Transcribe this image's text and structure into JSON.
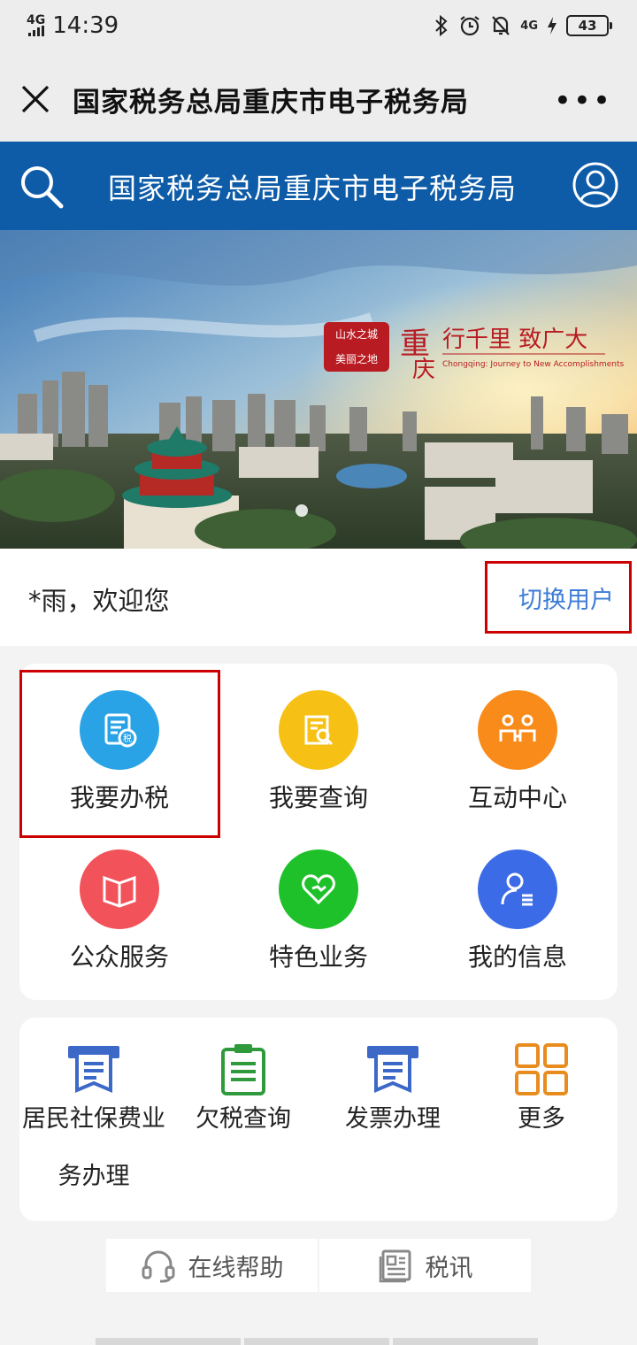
{
  "status_bar": {
    "network": "4G",
    "time": "14:39",
    "network_right": "4G",
    "battery": "43"
  },
  "nav": {
    "title": "国家税务总局重庆市电子税务局",
    "more": "•••"
  },
  "header": {
    "title": "国家税务总局重庆市电子税务局"
  },
  "banner": {
    "seal_text": "山水之城 美丽之地",
    "brand": "重庆",
    "slogan": "行千里 致广大",
    "slogan_en": "Chongqing: Journey to New Accomplishments",
    "carousel_position": 1
  },
  "welcome": {
    "greeting": "*雨，欢迎您",
    "switch_user": "切换用户"
  },
  "main_tiles": [
    {
      "label": "我要办税",
      "icon": "tax-document-icon",
      "color": "#29a3e6"
    },
    {
      "label": "我要查询",
      "icon": "search-document-icon",
      "color": "#f6c015"
    },
    {
      "label": "互动中心",
      "icon": "interaction-icon",
      "color": "#f98b1a"
    },
    {
      "label": "公众服务",
      "icon": "book-icon",
      "color": "#f2525a"
    },
    {
      "label": "特色业务",
      "icon": "heart-icon",
      "color": "#1fc12a"
    },
    {
      "label": "我的信息",
      "icon": "profile-icon",
      "color": "#3b6be7"
    }
  ],
  "quick_links": [
    {
      "label_line1": "居民社保费业",
      "label_line2": "务办理",
      "icon": "printer-receipt-icon",
      "color": "#3c68c8"
    },
    {
      "label_line1": "欠税查询",
      "icon": "clipboard-icon",
      "color": "#2f9a3c"
    },
    {
      "label_line1": "发票办理",
      "icon": "invoice-icon",
      "color": "#3c68c8"
    },
    {
      "label_line1": "更多",
      "icon": "grid-icon",
      "color": "#e88c1e"
    }
  ],
  "bottom_links": {
    "help": "在线帮助",
    "news": "税讯"
  }
}
